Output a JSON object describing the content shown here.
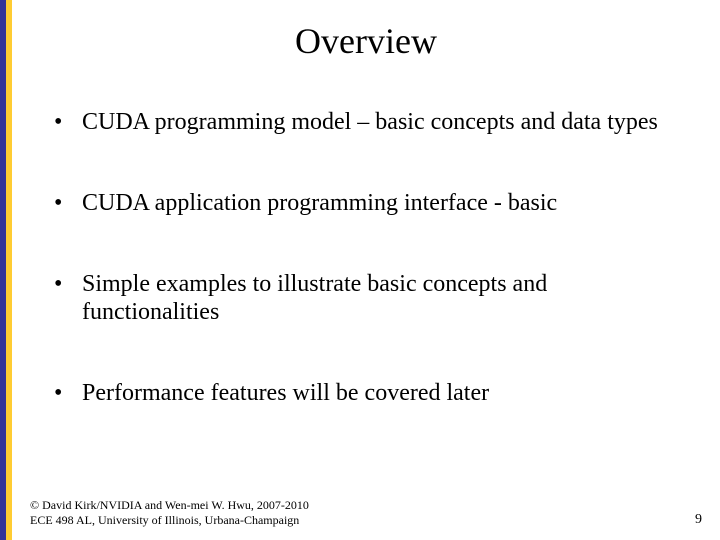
{
  "slide": {
    "title": "Overview",
    "bullets": [
      "CUDA programming model – basic concepts and data types",
      "CUDA application programming interface - basic",
      "Simple examples to illustrate basic concepts and functionalities",
      "Performance features will be covered later"
    ],
    "footer": {
      "line1": "© David Kirk/NVIDIA and Wen-mei W. Hwu, 2007-2010",
      "line2": "ECE 498 AL, University of Illinois, Urbana-Champaign",
      "page_number": "9"
    }
  }
}
